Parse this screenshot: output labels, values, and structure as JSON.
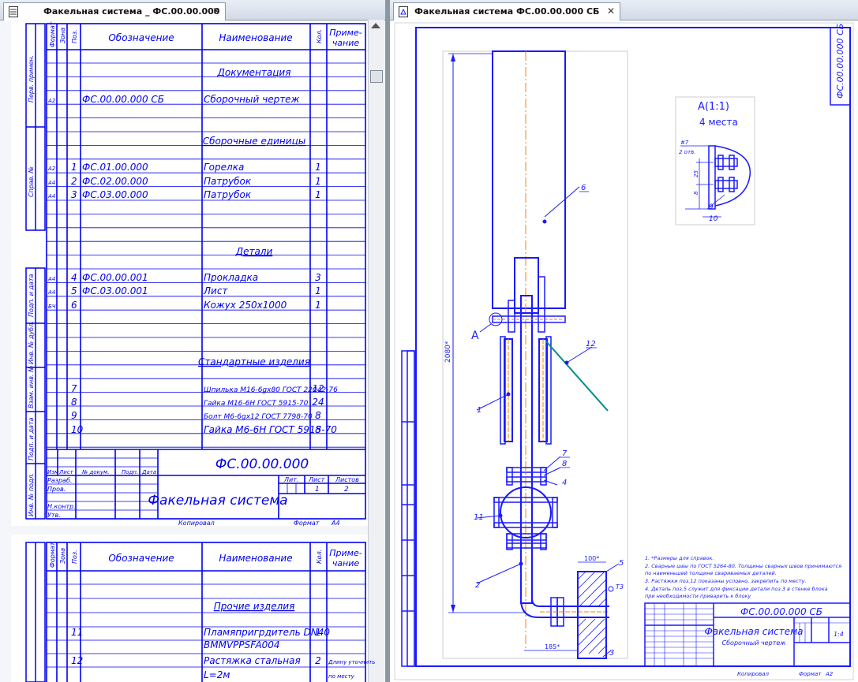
{
  "tabs": {
    "left": {
      "title": "Факельная система _ ФС.00.00.000"
    },
    "right": {
      "title": "Факельная система ФС.00.00.000 СБ"
    }
  },
  "spec": {
    "headers": {
      "format": "Формат",
      "zone": "Зона",
      "pos": "Поз.",
      "designation": "Обозначение",
      "name": "Наименование",
      "qty": "Кол.",
      "note1": "Приме-",
      "note2": "чание"
    },
    "sections": {
      "docs": "Документация",
      "units": "Сборочные единицы",
      "details": "Детали",
      "standard": "Стандартные изделия",
      "other": "Прочие изделия"
    },
    "rows": [
      {
        "fmt": "A2",
        "pos": "",
        "des": "ФС.00.00.000 СБ",
        "name": "Сборочный чертеж",
        "qty": ""
      },
      {
        "fmt": "A2",
        "pos": "1",
        "des": "ФС.01.00.000",
        "name": "Горелка",
        "qty": "1"
      },
      {
        "fmt": "A4",
        "pos": "2",
        "des": "ФС.02.00.000",
        "name": "Патрубок",
        "qty": "1"
      },
      {
        "fmt": "A4",
        "pos": "3",
        "des": "ФС.03.00.000",
        "name": "Патрубок",
        "qty": "1"
      },
      {
        "fmt": "A4",
        "pos": "4",
        "des": "ФС.00.00.001",
        "name": "Прокладка",
        "qty": "3"
      },
      {
        "fmt": "A4",
        "pos": "5",
        "des": "ФС.03.00.001",
        "name": "Лист",
        "qty": "1"
      },
      {
        "fmt": "БЧ",
        "pos": "6",
        "des": "",
        "name": "Кожух 250х1000",
        "qty": "1"
      },
      {
        "fmt": "",
        "pos": "7",
        "des": "",
        "name": "Шпилька М16-6gх80 ГОСТ 22042-76",
        "qty": "12"
      },
      {
        "fmt": "",
        "pos": "8",
        "des": "",
        "name": "Гайка М16-6Н ГОСТ 5915-70",
        "qty": "24"
      },
      {
        "fmt": "",
        "pos": "9",
        "des": "",
        "name": "Болт М6-6gх12 ГОСТ 7798-70",
        "qty": "8"
      },
      {
        "fmt": "",
        "pos": "10",
        "des": "",
        "name": "Гайка М6-6Н ГОСТ 5915-70",
        "qty": "8"
      },
      {
        "fmt": "",
        "pos": "11",
        "des": "",
        "name": "Пламяпригрдитель DN40",
        "qty": "1"
      },
      {
        "fmt": "",
        "pos": "",
        "des": "",
        "name": "BMMVPPSFA004",
        "qty": ""
      },
      {
        "fmt": "",
        "pos": "12",
        "des": "",
        "name": "Растяжка стальная",
        "qty": "2",
        "note": "Длину уточнить"
      },
      {
        "fmt": "",
        "pos": "",
        "des": "",
        "name": "L=2м",
        "qty": "",
        "note": "по месту"
      }
    ],
    "sidebar": [
      "Перв. примен.",
      "Справ. №",
      "Подп. и дата",
      "Инв. № дубл.",
      "Взам. инв. №",
      "Подп. и дата",
      "Инв. № подл."
    ],
    "stamp": {
      "code": "ФС.00.00.000",
      "title": "Факельная система",
      "cols": [
        "Изм",
        "Лист",
        "№ докум.",
        "Подп.",
        "Дата"
      ],
      "roles": [
        "Разраб.",
        "Пров.",
        "Н.контр.",
        "Утв."
      ],
      "lit": "Лит.",
      "sheet": "Лист",
      "sheets": "Листов",
      "sheet_val": "1",
      "sheets_val": "2",
      "copied": "Копировал",
      "format_label": "Формат",
      "format_val": "А4"
    }
  },
  "drawing": {
    "view_label": "A(1:1)",
    "view_note": "4 места",
    "detail_ref": "A",
    "height_dim": "2080*",
    "dim_100": "100*",
    "dim_185": "185*",
    "detail_dims": [
      "#7",
      "2 отв.",
      "25",
      "8"
    ],
    "balloons": [
      "1",
      "2",
      "3",
      "4",
      "5",
      "6",
      "7",
      "8",
      "9",
      "10",
      "11",
      "12",
      "Т3"
    ],
    "side_code": "ФС.00.00.000 СБ",
    "notes": [
      "1. *Размеры для справок.",
      "2. Сварные швы по ГОСТ 5264-80. Толщины сварных швов принимаются",
      "по наименьшей толщине свариваемых деталей.",
      "3. Растяжки поз.12 показаны условно, закрепить по месту.",
      "4. Деталь поз.5 служит для фиксации детали поз.3 в стенке блока",
      "при необходимости приварить к блоку"
    ],
    "stamp": {
      "code": "ФС.00.00.000 СБ",
      "title": "Факельная система",
      "subtitle": "Сборочный чертеж",
      "scale": "1:4",
      "copied": "Копировал",
      "format": "Формат",
      "format_val": "А2"
    }
  },
  "colors": {
    "line": "#1a1aff",
    "teal": "#008b8b",
    "axis": "#ff7f00"
  }
}
